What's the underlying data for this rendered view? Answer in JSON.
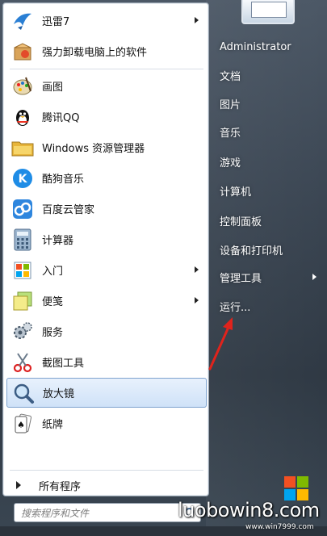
{
  "programs": [
    {
      "label": "迅雷7",
      "icon": "xunlei-bird-icon",
      "has_submenu": true
    },
    {
      "label": "强力卸载电脑上的软件",
      "icon": "uninstall-box-icon",
      "has_submenu": false
    },
    {
      "label": "画图",
      "icon": "paint-palette-icon",
      "has_submenu": false
    },
    {
      "label": "腾讯QQ",
      "icon": "qq-penguin-icon",
      "has_submenu": false
    },
    {
      "label": "Windows 资源管理器",
      "icon": "folder-explorer-icon",
      "has_submenu": false
    },
    {
      "label": "酷狗音乐",
      "icon": "kugou-k-icon",
      "has_submenu": false
    },
    {
      "label": "百度云管家",
      "icon": "baidu-cloud-icon",
      "has_submenu": false
    },
    {
      "label": "计算器",
      "icon": "calculator-icon",
      "has_submenu": false
    },
    {
      "label": "入门",
      "icon": "getting-started-icon",
      "has_submenu": true
    },
    {
      "label": "便笺",
      "icon": "sticky-notes-icon",
      "has_submenu": true
    },
    {
      "label": "服务",
      "icon": "gears-icon",
      "has_submenu": false
    },
    {
      "label": "截图工具",
      "icon": "scissors-icon",
      "has_submenu": false
    },
    {
      "label": "放大镜",
      "icon": "magnifier-icon",
      "has_submenu": false,
      "selected": true
    },
    {
      "label": "纸牌",
      "icon": "cards-icon",
      "has_submenu": false
    }
  ],
  "all_programs_label": "所有程序",
  "search": {
    "placeholder": "搜索程序和文件"
  },
  "right_items": [
    {
      "label": "Administrator",
      "has_submenu": false
    },
    {
      "label": "文档",
      "has_submenu": false
    },
    {
      "label": "图片",
      "has_submenu": false
    },
    {
      "label": "音乐",
      "has_submenu": false
    },
    {
      "label": "游戏",
      "has_submenu": false
    },
    {
      "label": "计算机",
      "has_submenu": false
    },
    {
      "label": "控制面板",
      "has_submenu": false
    },
    {
      "label": "设备和打印机",
      "has_submenu": false
    },
    {
      "label": "管理工具",
      "has_submenu": true
    },
    {
      "label": "运行...",
      "has_submenu": false
    }
  ],
  "watermark": {
    "main": "luobowin8.com",
    "sub": "www.win7999.com"
  },
  "colors": {
    "selection_border": "#7da2ce",
    "annotation_arrow": "#e0231c",
    "menu_glass": "#3c4754"
  }
}
